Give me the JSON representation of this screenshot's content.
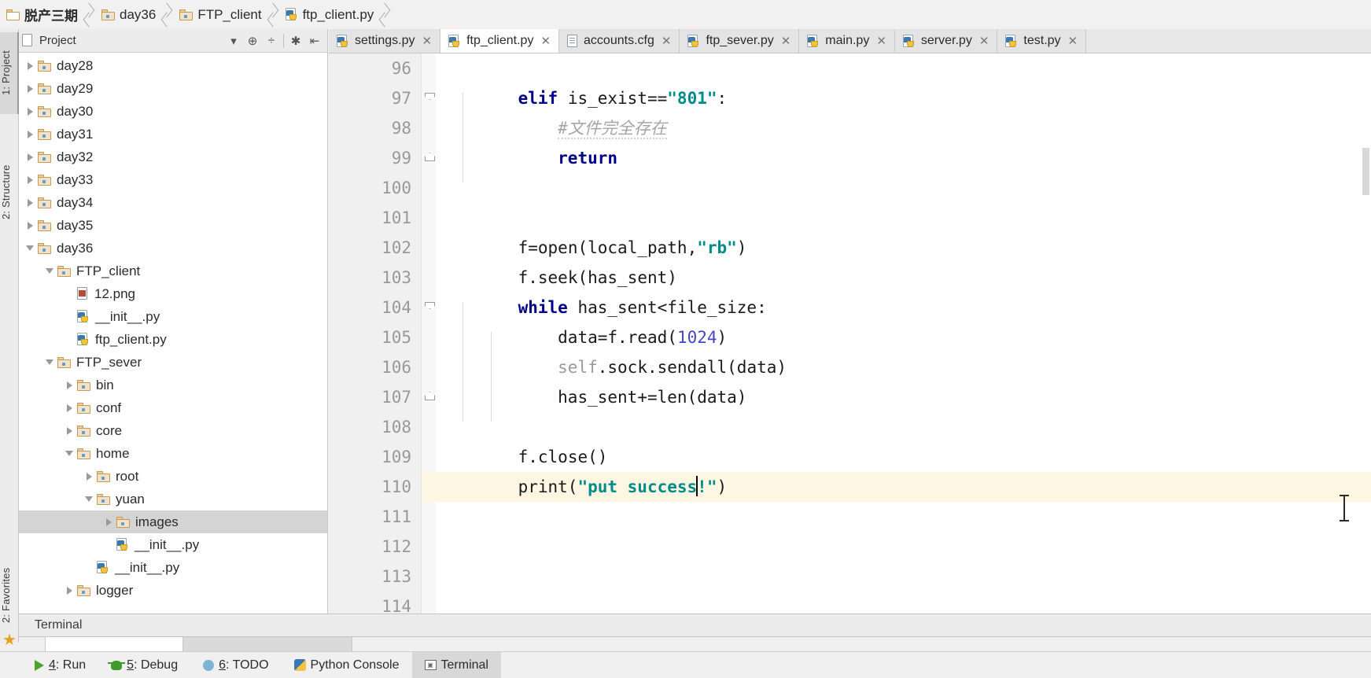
{
  "breadcrumb": {
    "items": [
      {
        "label": "脱产三期",
        "icon": "folder-icon",
        "active": true
      },
      {
        "label": "day36",
        "icon": "folder-icon",
        "active": false
      },
      {
        "label": "FTP_client",
        "icon": "folder-icon",
        "active": false
      },
      {
        "label": "ftp_client.py",
        "icon": "python-file-icon",
        "active": false
      }
    ]
  },
  "left_strip": {
    "tabs": [
      {
        "label": "1: Project",
        "selected": true
      },
      {
        "label": "2: Structure",
        "selected": false
      },
      {
        "label": "2: Favorites",
        "selected": false
      }
    ]
  },
  "project_panel": {
    "title": "Project",
    "toolbar": [
      {
        "name": "chevron-down-icon",
        "glyph": "▾"
      },
      {
        "name": "target-icon",
        "glyph": "⊕"
      },
      {
        "name": "collapse-all-icon",
        "glyph": "÷"
      },
      {
        "name": "gear-icon",
        "glyph": "✱"
      },
      {
        "name": "hide-icon",
        "glyph": "⇤"
      }
    ],
    "tree": [
      {
        "label": "day28",
        "indent": 1,
        "arrow": "right",
        "icon": "folder-icon",
        "selected": false
      },
      {
        "label": "day29",
        "indent": 1,
        "arrow": "right",
        "icon": "folder-icon",
        "selected": false
      },
      {
        "label": "day30",
        "indent": 1,
        "arrow": "right",
        "icon": "folder-icon",
        "selected": false
      },
      {
        "label": "day31",
        "indent": 1,
        "arrow": "right",
        "icon": "folder-icon",
        "selected": false
      },
      {
        "label": "day32",
        "indent": 1,
        "arrow": "right",
        "icon": "folder-icon",
        "selected": false
      },
      {
        "label": "day33",
        "indent": 1,
        "arrow": "right",
        "icon": "folder-icon",
        "selected": false
      },
      {
        "label": "day34",
        "indent": 1,
        "arrow": "right",
        "icon": "folder-icon",
        "selected": false
      },
      {
        "label": "day35",
        "indent": 1,
        "arrow": "right",
        "icon": "folder-icon",
        "selected": false
      },
      {
        "label": "day36",
        "indent": 1,
        "arrow": "down",
        "icon": "folder-icon",
        "selected": false
      },
      {
        "label": "FTP_client",
        "indent": 2,
        "arrow": "down",
        "icon": "folder-icon",
        "selected": false
      },
      {
        "label": "12.png",
        "indent": 3,
        "arrow": "none",
        "icon": "png-file-icon",
        "selected": false
      },
      {
        "label": "__init__.py",
        "indent": 3,
        "arrow": "none",
        "icon": "python-file-icon",
        "selected": false
      },
      {
        "label": "ftp_client.py",
        "indent": 3,
        "arrow": "none",
        "icon": "python-file-icon",
        "selected": false
      },
      {
        "label": "FTP_sever",
        "indent": 2,
        "arrow": "down",
        "icon": "folder-icon",
        "selected": false
      },
      {
        "label": "bin",
        "indent": 3,
        "arrow": "right",
        "icon": "folder-icon",
        "selected": false
      },
      {
        "label": "conf",
        "indent": 3,
        "arrow": "right",
        "icon": "folder-icon",
        "selected": false
      },
      {
        "label": "core",
        "indent": 3,
        "arrow": "right",
        "icon": "folder-icon",
        "selected": false
      },
      {
        "label": "home",
        "indent": 3,
        "arrow": "down",
        "icon": "folder-icon",
        "selected": false
      },
      {
        "label": "root",
        "indent": 4,
        "arrow": "right",
        "icon": "folder-icon",
        "selected": false
      },
      {
        "label": "yuan",
        "indent": 4,
        "arrow": "down",
        "icon": "folder-icon",
        "selected": false
      },
      {
        "label": "images",
        "indent": 5,
        "arrow": "right",
        "icon": "folder-icon",
        "selected": true
      },
      {
        "label": "__init__.py",
        "indent": 5,
        "arrow": "none",
        "icon": "python-file-icon",
        "selected": false
      },
      {
        "label": "__init__.py",
        "indent": 4,
        "arrow": "none",
        "icon": "python-file-icon",
        "selected": false
      },
      {
        "label": "logger",
        "indent": 3,
        "arrow": "right",
        "icon": "folder-icon",
        "selected": false
      }
    ]
  },
  "editor_tabs": [
    {
      "label": "settings.py",
      "icon": "python-file-icon",
      "active": false,
      "close": "✕"
    },
    {
      "label": "ftp_client.py",
      "icon": "python-file-icon",
      "active": true,
      "close": "✕"
    },
    {
      "label": "accounts.cfg",
      "icon": "cfg-file-icon",
      "active": false,
      "close": "✕"
    },
    {
      "label": "ftp_sever.py",
      "icon": "python-file-icon",
      "active": false,
      "close": "✕"
    },
    {
      "label": "main.py",
      "icon": "python-file-icon",
      "active": false,
      "close": "✕"
    },
    {
      "label": "server.py",
      "icon": "python-file-icon",
      "active": false,
      "close": "✕"
    },
    {
      "label": "test.py",
      "icon": "python-file-icon",
      "active": false,
      "close": "✕"
    }
  ],
  "editor": {
    "language": "python",
    "first_line_number": 96,
    "current_line": 110,
    "lines": [
      {
        "n": 96,
        "text": ""
      },
      {
        "n": 97,
        "text": "    elif is_exist==\"801\":"
      },
      {
        "n": 98,
        "text": "        #文件完全存在"
      },
      {
        "n": 99,
        "text": "        return"
      },
      {
        "n": 100,
        "text": ""
      },
      {
        "n": 101,
        "text": ""
      },
      {
        "n": 102,
        "text": "    f=open(local_path,\"rb\")"
      },
      {
        "n": 103,
        "text": "    f.seek(has_sent)"
      },
      {
        "n": 104,
        "text": "    while has_sent<file_size:"
      },
      {
        "n": 105,
        "text": "        data=f.read(1024)"
      },
      {
        "n": 106,
        "text": "        self.sock.sendall(data)"
      },
      {
        "n": 107,
        "text": "        has_sent+=len(data)"
      },
      {
        "n": 108,
        "text": ""
      },
      {
        "n": 109,
        "text": "    f.close()"
      },
      {
        "n": 110,
        "text": "    print(\"put success!\")"
      },
      {
        "n": 111,
        "text": ""
      },
      {
        "n": 112,
        "text": ""
      },
      {
        "n": 113,
        "text": ""
      },
      {
        "n": 114,
        "text": ""
      }
    ]
  },
  "terminal_panel": {
    "title": "Terminal"
  },
  "status_bar": {
    "items": [
      {
        "label": "4: Run",
        "mnemonic": "4",
        "icon": "run-icon",
        "selected": false
      },
      {
        "label": "5: Debug",
        "mnemonic": "5",
        "icon": "debug-icon",
        "selected": false
      },
      {
        "label": "6: TODO",
        "mnemonic": "6",
        "icon": "todo-icon",
        "selected": false
      },
      {
        "label": "Python Console",
        "mnemonic": "",
        "icon": "python-console-icon",
        "selected": false
      },
      {
        "label": "Terminal",
        "mnemonic": "",
        "icon": "terminal-icon",
        "selected": true
      }
    ]
  },
  "colors": {
    "keyword": "#00008b",
    "string": "#008b8b",
    "number": "#4646c8",
    "comment": "#a6a6a6",
    "current_line_bg": "#fdf6e3",
    "selection_bg": "#d4d4d4"
  }
}
